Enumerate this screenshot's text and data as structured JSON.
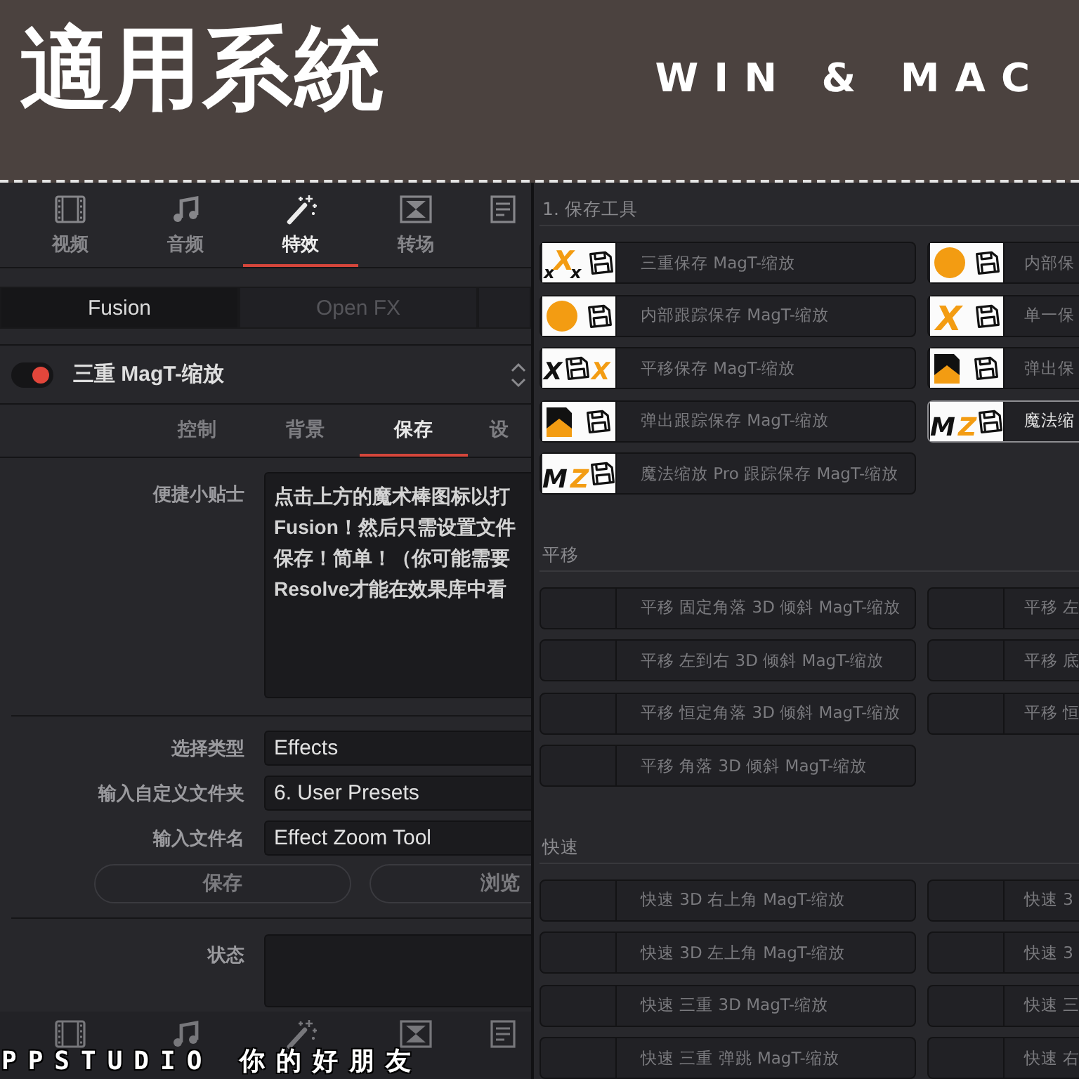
{
  "header": {
    "title": "適用系統",
    "platforms": "WIN & MAC"
  },
  "inspector": {
    "tabs": [
      {
        "label": "视频",
        "selected": false
      },
      {
        "label": "音频",
        "selected": false
      },
      {
        "label": "特效",
        "selected": true
      },
      {
        "label": "转场",
        "selected": false
      },
      {
        "selected": false
      }
    ],
    "modes": [
      {
        "label": "Fusion",
        "selected": true
      },
      {
        "label": "Open FX",
        "selected": false
      },
      {
        "selected": false
      }
    ],
    "node": {
      "title": "三重 MagT-缩放",
      "enabled": true
    },
    "subtabs": [
      {
        "label": "控制",
        "selected": false
      },
      {
        "label": "背景",
        "selected": false
      },
      {
        "label": "保存",
        "selected": true
      },
      {
        "label": "设",
        "selected": false
      }
    ],
    "tip": {
      "label": "便捷小贴士",
      "lines": [
        "点击上方的魔术棒图标以打",
        "Fusion！然后只需设置文件",
        "保存！简单！（你可能需要",
        "Resolve才能在效果库中看"
      ]
    },
    "fields": [
      {
        "label": "选择类型",
        "value": "Effects"
      },
      {
        "label": "输入自定义文件夹",
        "value": "6. User Presets"
      },
      {
        "label": "输入文件名",
        "value": "Effect Zoom Tool"
      }
    ],
    "buttons": [
      "保存",
      "浏览"
    ],
    "status": {
      "label": "状态"
    }
  },
  "presets": {
    "sections": [
      {
        "title": "1. 保存工具",
        "items": [
          {
            "label": "三重保存 MagT-缩放",
            "kind": "triple",
            "thumb_text": [
              "x",
              "X",
              "x"
            ],
            "selected": false
          },
          {
            "label": "内部保",
            "kind": "circle",
            "selected": false
          },
          {
            "label": "内部跟踪保存 MagT-缩放",
            "kind": "circle",
            "selected": false
          },
          {
            "label": "单一保",
            "kind": "single",
            "thumb_text": [
              "X"
            ],
            "selected": false
          },
          {
            "label": "平移保存 MagT-缩放",
            "kind": "pan",
            "thumb_text": [
              "X",
              "X"
            ],
            "selected": false
          },
          {
            "label": "弹出保",
            "kind": "popup",
            "selected": false
          },
          {
            "label": "弹出跟踪保存 MagT-缩放",
            "kind": "popup",
            "selected": false
          },
          {
            "label": "魔法缩",
            "kind": "mz",
            "thumb_text": [
              "M",
              "Z"
            ],
            "selected": true
          },
          {
            "label": "魔法缩放 Pro 跟踪保存 MagT-缩放",
            "kind": "mz",
            "thumb_text": [
              "M",
              "Z"
            ],
            "selected": false
          }
        ]
      },
      {
        "title": "平移",
        "items": [
          {
            "label": "平移 固定角落 3D 倾斜 MagT-缩放",
            "selected": false
          },
          {
            "label": "平移 左",
            "selected": false
          },
          {
            "label": "平移 左到右 3D 倾斜 MagT-缩放",
            "selected": false
          },
          {
            "label": "平移 底",
            "selected": false
          },
          {
            "label": "平移 恒定角落 3D 倾斜 MagT-缩放",
            "selected": false
          },
          {
            "label": "平移 恒",
            "selected": false
          },
          {
            "label": "平移 角落 3D 倾斜 MagT-缩放",
            "selected": false
          }
        ]
      },
      {
        "title": "快速",
        "items": [
          {
            "label": "快速 3D 右上角 MagT-缩放",
            "selected": false
          },
          {
            "label": "快速 3",
            "selected": false
          },
          {
            "label": "快速 3D 左上角 MagT-缩放",
            "selected": false
          },
          {
            "label": "快速 3",
            "selected": false
          },
          {
            "label": "快速 三重 3D MagT-缩放",
            "selected": false
          },
          {
            "label": "快速 三",
            "selected": false
          },
          {
            "label": "快速 三重 弹跳 MagT-缩放",
            "selected": false
          },
          {
            "label": "快速 右",
            "selected": false
          }
        ]
      }
    ]
  },
  "caption": "PPSTUDIO 你的好朋友"
}
